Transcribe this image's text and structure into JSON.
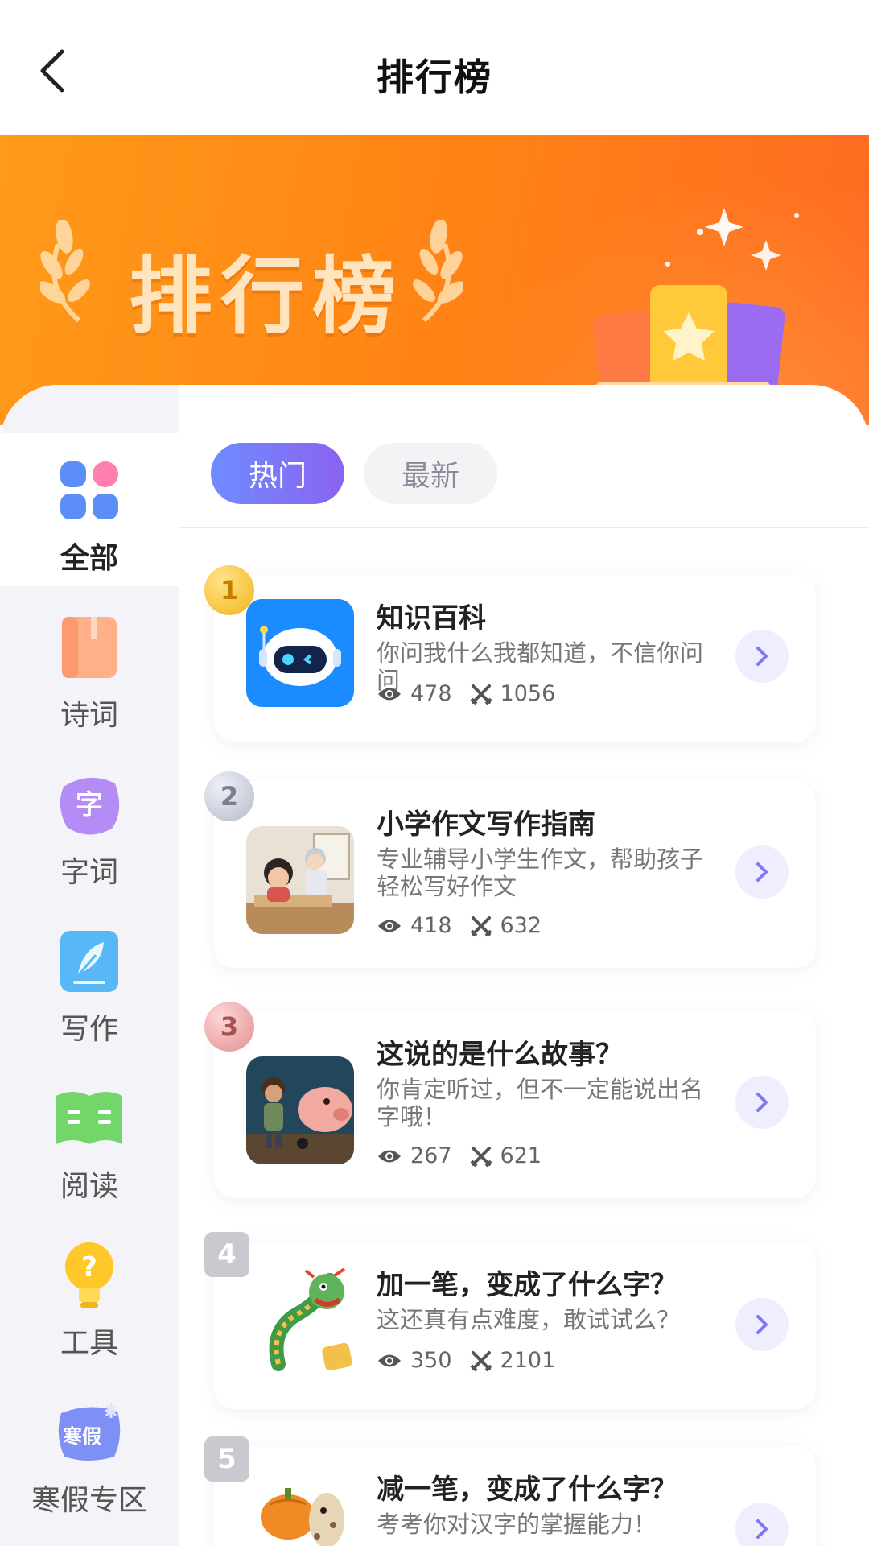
{
  "header": {
    "title": "排行榜"
  },
  "banner": {
    "title": "排行榜"
  },
  "sidebar": {
    "items": [
      {
        "label": "全部",
        "icon": "grid-icon",
        "active": true
      },
      {
        "label": "诗词",
        "icon": "book-icon",
        "active": false
      },
      {
        "label": "字词",
        "icon": "character-icon",
        "active": false
      },
      {
        "label": "写作",
        "icon": "feather-icon",
        "active": false
      },
      {
        "label": "阅读",
        "icon": "open-book-icon",
        "active": false
      },
      {
        "label": "工具",
        "icon": "lightbulb-icon",
        "active": false
      },
      {
        "label": "寒假专区",
        "icon": "winter-badge-icon",
        "active": false
      }
    ],
    "winter_badge_text": "寒假"
  },
  "tabs": [
    {
      "label": "热门",
      "active": true
    },
    {
      "label": "最新",
      "active": false
    }
  ],
  "list": [
    {
      "rank": "1",
      "title": "知识百科",
      "desc": "你问我什么我都知道，不信你问问",
      "views": "478",
      "battles": "1056",
      "thumb": "robot-image"
    },
    {
      "rank": "2",
      "title": "小学作文写作指南",
      "desc": "专业辅导小学生作文，帮助孩子轻松写好作文",
      "views": "418",
      "battles": "632",
      "thumb": "classroom-image"
    },
    {
      "rank": "3",
      "title": "这说的是什么故事？",
      "desc": "你肯定听过，但不一定能说出名字哦！",
      "views": "267",
      "battles": "621",
      "thumb": "boy-pig-image"
    },
    {
      "rank": "4",
      "title": "加一笔，变成了什么字？",
      "desc": "这还真有点难度，敢试试么？",
      "views": "350",
      "battles": "2101",
      "thumb": "dragon-image"
    },
    {
      "rank": "5",
      "title": "减一笔，变成了什么字？",
      "desc": "考考你对汉字的掌握能力！",
      "views": "",
      "battles": "",
      "thumb": "pumpkin-horse-image"
    }
  ],
  "colors": {
    "accent": "#7f78f5",
    "banner": "#ff8614",
    "sidebar_bg": "#f4f4f8"
  }
}
